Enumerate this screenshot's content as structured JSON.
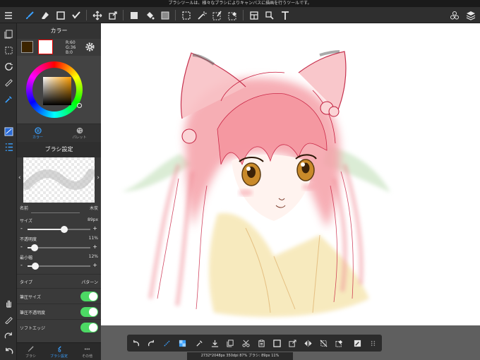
{
  "tooltip": "ブラシツールは、様々なブラシによりキャンバスに描画を行うツールです。",
  "toolbar": {
    "tools": [
      {
        "icon": "menu-icon",
        "active": false
      },
      {
        "icon": "brush-icon",
        "active": true
      },
      {
        "icon": "eraser-icon",
        "active": false
      },
      {
        "icon": "rectangle-select-icon",
        "active": false
      },
      {
        "icon": "smudge-icon",
        "active": false
      },
      {
        "icon": "move-icon",
        "active": false
      },
      {
        "icon": "transform-icon",
        "active": false
      },
      {
        "icon": "fill-rect-icon",
        "active": false
      },
      {
        "icon": "bucket-icon",
        "active": false
      },
      {
        "icon": "gradient-icon",
        "active": false
      },
      {
        "icon": "selection-icon",
        "active": false
      },
      {
        "icon": "magic-wand-icon",
        "active": false
      },
      {
        "icon": "select-pen-icon",
        "active": false
      },
      {
        "icon": "select-eraser-icon",
        "active": false
      },
      {
        "icon": "frame-divide-icon",
        "active": false
      },
      {
        "icon": "operation-icon",
        "active": false
      },
      {
        "icon": "text-icon",
        "active": false
      },
      {
        "icon": "material-icon",
        "active": false
      },
      {
        "icon": "layers-icon",
        "active": false
      }
    ]
  },
  "left_tools": [
    "pages-icon",
    "layer-select-icon",
    "rotate-icon",
    "ruler-icon",
    "eyedropper-icon",
    "color-panel-icon",
    "layer-list-icon",
    "hand-icon",
    "pen-icon",
    "redo-icon",
    "undo-icon"
  ],
  "color_panel": {
    "title": "カラー",
    "rgb": {
      "r": "R:60",
      "g": "G:36",
      "b": "B:0"
    },
    "main_color": "#3c2400",
    "tabs": [
      {
        "label": "カラー",
        "active": true
      },
      {
        "label": "パレット",
        "active": false
      }
    ]
  },
  "brush_panel": {
    "title": "ブラシ設定",
    "name_label": "名前",
    "name_value": "木炭",
    "size_label": "サイズ",
    "size_value": "89px",
    "size_fraction": 0.58,
    "opacity_label": "不透明度",
    "opacity_value": "11%",
    "opacity_fraction": 0.11,
    "min_width_label": "最小幅",
    "min_width_value": "12%",
    "min_width_fraction": 0.12,
    "type_label": "タイプ",
    "type_value": "パターン",
    "toggles": [
      {
        "label": "筆圧サイズ",
        "on": true
      },
      {
        "label": "筆圧不透明度",
        "on": true
      },
      {
        "label": "ソフトエッジ",
        "on": true
      }
    ]
  },
  "panel_tabs": [
    {
      "label": "ブラシ",
      "active": false
    },
    {
      "label": "ブラシ設定",
      "active": true
    },
    {
      "label": "その他",
      "active": false
    }
  ],
  "status_text": "2732*2048px 350dpi 87% ブラシ: 89px 11%",
  "bottom_tools": [
    "undo-icon",
    "redo-icon",
    "stabilizer-icon",
    "transparency-icon",
    "eyedropper-icon",
    "download-icon",
    "copy-icon",
    "cut-icon",
    "paste-icon",
    "canvas-frame-icon",
    "transform-icon",
    "flip-icon",
    "deselect-icon",
    "select-eraser-icon",
    "edit-icon",
    "grip-icon"
  ]
}
